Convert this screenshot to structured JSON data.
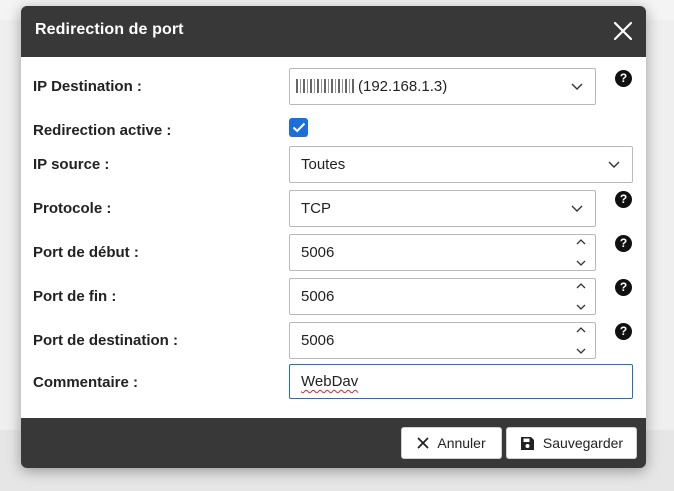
{
  "dialog": {
    "title": "Redirection de port"
  },
  "form": {
    "ip_destination": {
      "label": "IP Destination :",
      "value": "(192.168.1.3)"
    },
    "redirection_active": {
      "label": "Redirection active :",
      "checked": true
    },
    "ip_source": {
      "label": "IP source :",
      "value": "Toutes"
    },
    "protocole": {
      "label": "Protocole :",
      "value": "TCP"
    },
    "port_debut": {
      "label": "Port de début :",
      "value": "5006"
    },
    "port_fin": {
      "label": "Port de fin :",
      "value": "5006"
    },
    "port_destination": {
      "label": "Port de destination :",
      "value": "5006"
    },
    "commentaire": {
      "label": "Commentaire :",
      "value": "WebDav"
    },
    "help_glyph": "?"
  },
  "footer": {
    "cancel_label": "Annuler",
    "save_label": "Sauvegarder"
  },
  "colors": {
    "header_bg": "#383838",
    "checkbox_accent": "#1b6fd8",
    "focus_border": "#1e6fd0"
  }
}
